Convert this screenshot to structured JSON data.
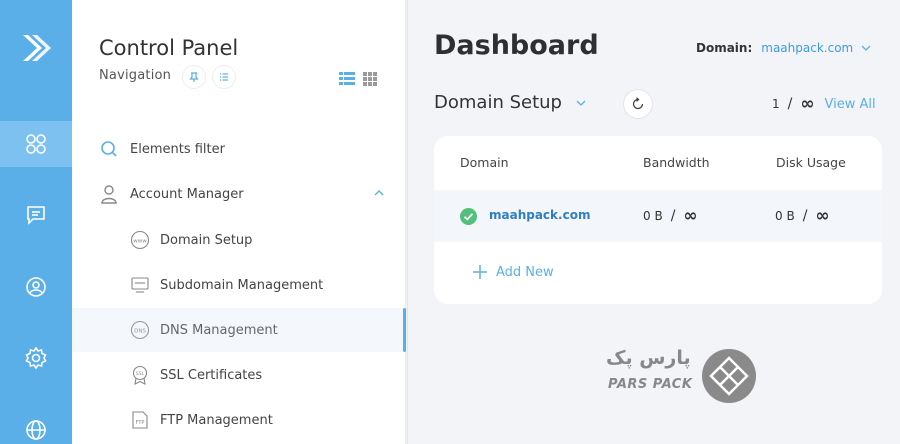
{
  "sidebar": {
    "title": "Control Panel",
    "subtitle": "Navigation",
    "filter_placeholder": "Elements filter",
    "group_label": "Account Manager",
    "items": [
      {
        "label": "Domain Setup",
        "icon": "www-icon"
      },
      {
        "label": "Subdomain Management",
        "icon": "subdomain-icon"
      },
      {
        "label": "DNS Management",
        "icon": "dns-icon",
        "active": true
      },
      {
        "label": "SSL Certificates",
        "icon": "ssl-icon"
      },
      {
        "label": "FTP Management",
        "icon": "ftp-icon"
      }
    ]
  },
  "rail": {
    "icons": [
      "logo-icon",
      "apps-icon",
      "chat-icon",
      "user-icon",
      "settings-icon",
      "globe-icon"
    ],
    "accent": "#5aafe8"
  },
  "main": {
    "title": "Dashboard",
    "domain_label": "Domain:",
    "domain_value": "maahpack.com",
    "section_title": "Domain Setup",
    "pager_page": "1",
    "pager_sep": "/",
    "pager_total": "∞",
    "view_all": "View All",
    "table": {
      "headers": [
        "Domain",
        "Bandwidth",
        "Disk Usage"
      ],
      "rows": [
        {
          "domain": "maahpack.com",
          "bandwidth": "0 B",
          "bandwidth_total": "∞",
          "disk": "0 B",
          "disk_total": "∞",
          "status": "active"
        }
      ]
    },
    "add_new": "Add New"
  },
  "brand": {
    "name_fa": "پارس پک",
    "name_en": "PARS PACK"
  }
}
